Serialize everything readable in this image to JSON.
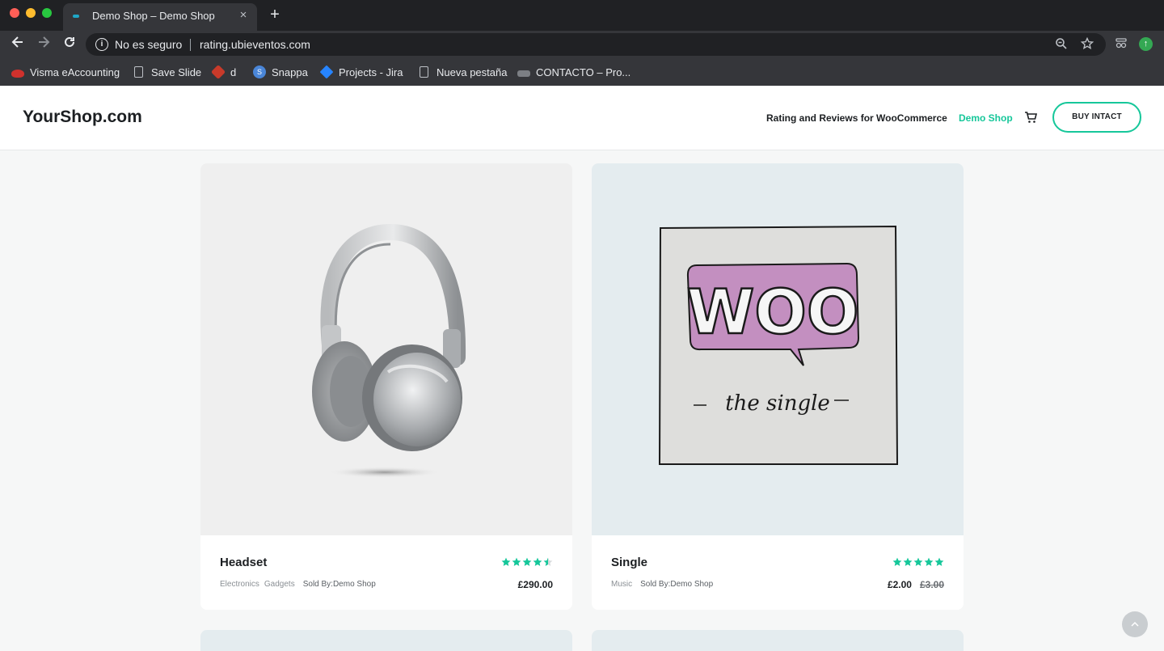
{
  "browser": {
    "tab_title": "Demo Shop – Demo Shop",
    "tab_close": "×",
    "new_tab": "+",
    "security_label": "No es seguro",
    "url": "rating.ubieventos.com",
    "bookmarks": [
      {
        "label": "Visma eAccounting",
        "icon": "visma-icon"
      },
      {
        "label": "Save Slide",
        "icon": "document-icon"
      },
      {
        "label": "d",
        "icon": "d-icon"
      },
      {
        "label": "Snappa",
        "icon": "snappa-icon"
      },
      {
        "label": "Projects - Jira",
        "icon": "jira-icon"
      },
      {
        "label": "Nueva pestaña",
        "icon": "document-icon"
      },
      {
        "label": "CONTACTO – Pro...",
        "icon": "contacto-icon"
      }
    ]
  },
  "header": {
    "logo": "YourShop.com",
    "nav": [
      {
        "label": "Rating and Reviews for WooCommerce",
        "active": false
      },
      {
        "label": "Demo Shop",
        "active": true
      }
    ],
    "buy_button": "BUY INTACT",
    "accent_color": "#16c79a"
  },
  "products": [
    {
      "name": "Headset",
      "rating": 4.5,
      "categories": [
        "Electronics",
        "Gadgets"
      ],
      "sold_by": "Sold By:Demo Shop",
      "price": "£290.00",
      "old_price": ""
    },
    {
      "name": "Single",
      "rating": 5,
      "categories": [
        "Music"
      ],
      "sold_by": "Sold By:Demo Shop",
      "price": "£2.00",
      "old_price": "£3.00",
      "image_text": {
        "brand": "WOO",
        "caption": "the single"
      }
    }
  ]
}
